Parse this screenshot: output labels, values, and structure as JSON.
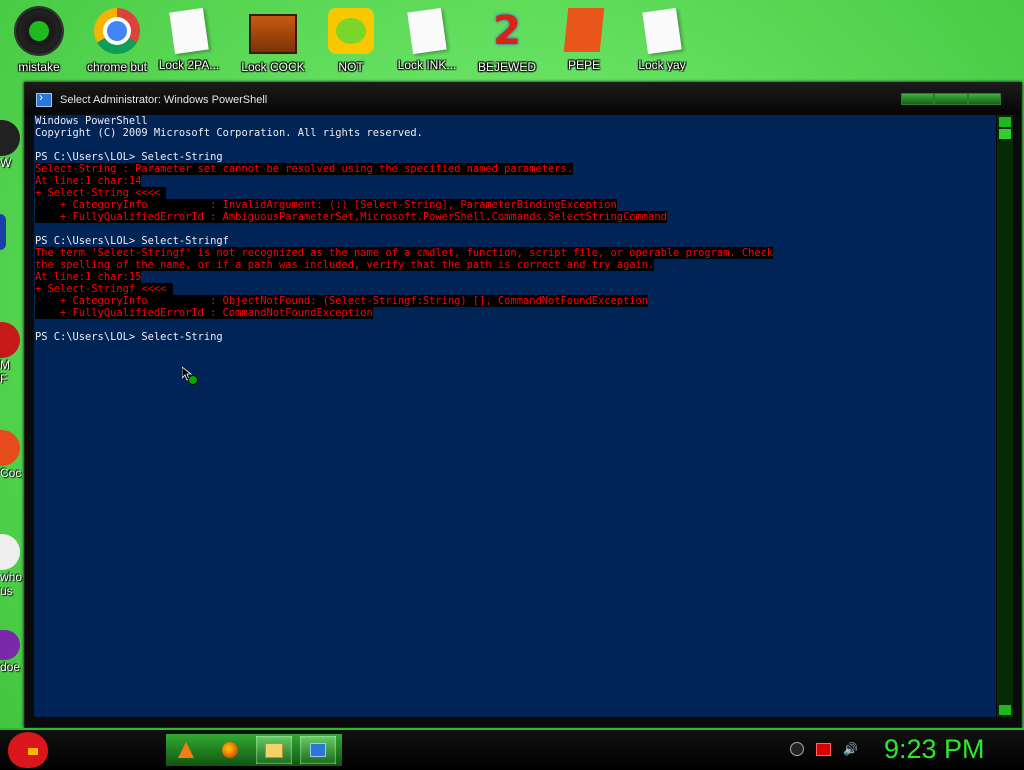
{
  "desktop": {
    "icons": [
      {
        "label": "mistake",
        "icon": "razer-icon"
      },
      {
        "label": "chrome but",
        "icon": "chrome-icon"
      },
      {
        "label": "Lock 2PA...",
        "icon": "document-icon"
      },
      {
        "label": "Lock COCK",
        "icon": "game-icon"
      },
      {
        "label": "NOT",
        "icon": "bad-piggies-icon"
      },
      {
        "label": "Lock INK...",
        "icon": "document-icon"
      },
      {
        "label": "BEJEWED",
        "icon": "bejeweled-icon"
      },
      {
        "label": "PEPE",
        "icon": "pepe-icon"
      },
      {
        "label": "Lock yay",
        "icon": "document-icon"
      }
    ],
    "left_partial_labels": [
      "W",
      "",
      "M\nF",
      "Coc",
      "who\nus",
      "doe"
    ]
  },
  "window": {
    "title": "Select Administrator: Windows PowerShell",
    "icon": "powershell-icon"
  },
  "console": {
    "background": "#012456",
    "error_color": "#ff0000",
    "lines": [
      {
        "text": "Windows PowerShell",
        "type": "normal"
      },
      {
        "text": "Copyright (C) 2009 Microsoft Corporation. All rights reserved.",
        "type": "normal"
      },
      {
        "text": "",
        "type": "normal"
      },
      {
        "text": "PS C:\\Users\\LOL> Select-String",
        "type": "normal"
      },
      {
        "text": "Select-String : Parameter set cannot be resolved using the specified named parameters.",
        "type": "error"
      },
      {
        "text": "At line:1 char:14",
        "type": "error"
      },
      {
        "text": "+ Select-String <<<< ",
        "type": "error"
      },
      {
        "text": "    + CategoryInfo          : InvalidArgument: (:) [Select-String], ParameterBindingException",
        "type": "error"
      },
      {
        "text": "    + FullyQualifiedErrorId : AmbiguousParameterSet,Microsoft.PowerShell.Commands.SelectStringCommand",
        "type": "error"
      },
      {
        "text": "",
        "type": "normal"
      },
      {
        "text": "PS C:\\Users\\LOL> Select-Stringf",
        "type": "normal"
      },
      {
        "text": "The term 'Select-Stringf' is not recognized as the name of a cmdlet, function, script file, or operable program. Check",
        "type": "error"
      },
      {
        "text": "the spelling of the name, or if a path was included, verify that the path is correct and try again.",
        "type": "error"
      },
      {
        "text": "At line:1 char:15",
        "type": "error"
      },
      {
        "text": "+ Select-Stringf <<<< ",
        "type": "error"
      },
      {
        "text": "    + CategoryInfo          : ObjectNotFound: (Select-Stringf:String) [], CommandNotFoundException",
        "type": "error"
      },
      {
        "text": "    + FullyQualifiedErrorId : CommandNotFoundException",
        "type": "error"
      },
      {
        "text": "",
        "type": "normal"
      },
      {
        "text": "PS C:\\Users\\LOL> Select-String",
        "type": "normal"
      }
    ]
  },
  "taskbar": {
    "start_icon": "angry-bird-icon",
    "pinned": [
      {
        "name": "vlc-icon",
        "active": false
      },
      {
        "name": "firefox-icon",
        "active": false
      },
      {
        "name": "folder-icon",
        "active": true
      },
      {
        "name": "powershell-icon",
        "active": true
      }
    ],
    "tray": [
      "tray-antivirus-icon",
      "tray-flag-icon",
      "volume-icon"
    ],
    "clock": "9:23 PM",
    "clock_color": "#2ce82c"
  }
}
